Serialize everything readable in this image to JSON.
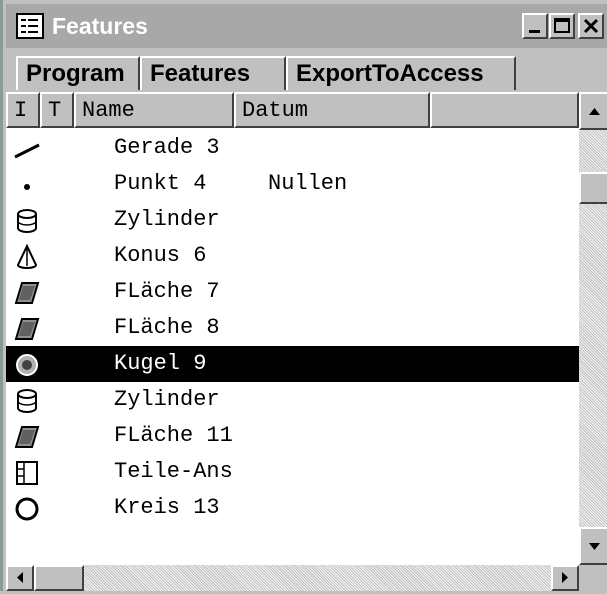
{
  "window": {
    "title": "Features",
    "title_icon": "list-icon",
    "buttons": [
      "minimize-icon",
      "maximize-icon",
      "close-icon"
    ]
  },
  "tabs": [
    {
      "label": "Program",
      "active": false
    },
    {
      "label": "Features",
      "active": true
    },
    {
      "label": "ExportToAccess",
      "active": false
    }
  ],
  "columns": [
    {
      "label": "I"
    },
    {
      "label": "T"
    },
    {
      "label": "Name"
    },
    {
      "label": "Datum"
    },
    {
      "label": ""
    }
  ],
  "rows": [
    {
      "icon": "line-icon",
      "name": "Gerade 3",
      "datum": "",
      "selected": false
    },
    {
      "icon": "point-icon",
      "name": "Punkt 4",
      "datum": "Nullen",
      "selected": false
    },
    {
      "icon": "cylinder-icon",
      "name": "Zylinder",
      "datum": "",
      "selected": false
    },
    {
      "icon": "cone-icon",
      "name": "Konus 6",
      "datum": "",
      "selected": false
    },
    {
      "icon": "surface-icon",
      "name": "FLäche 7",
      "datum": "",
      "selected": false
    },
    {
      "icon": "surface-icon",
      "name": "FLäche 8",
      "datum": "",
      "selected": false
    },
    {
      "icon": "sphere-icon",
      "name": "Kugel 9",
      "datum": "",
      "selected": true
    },
    {
      "icon": "cylinder-icon",
      "name": "Zylinder",
      "datum": "",
      "selected": false
    },
    {
      "icon": "surface-icon",
      "name": "FLäche 11",
      "datum": "",
      "selected": false
    },
    {
      "icon": "part-view-icon",
      "name": "Teile-Ans",
      "datum": "",
      "selected": false
    },
    {
      "icon": "circle-icon",
      "name": "Kreis 13",
      "datum": "",
      "selected": false
    }
  ]
}
